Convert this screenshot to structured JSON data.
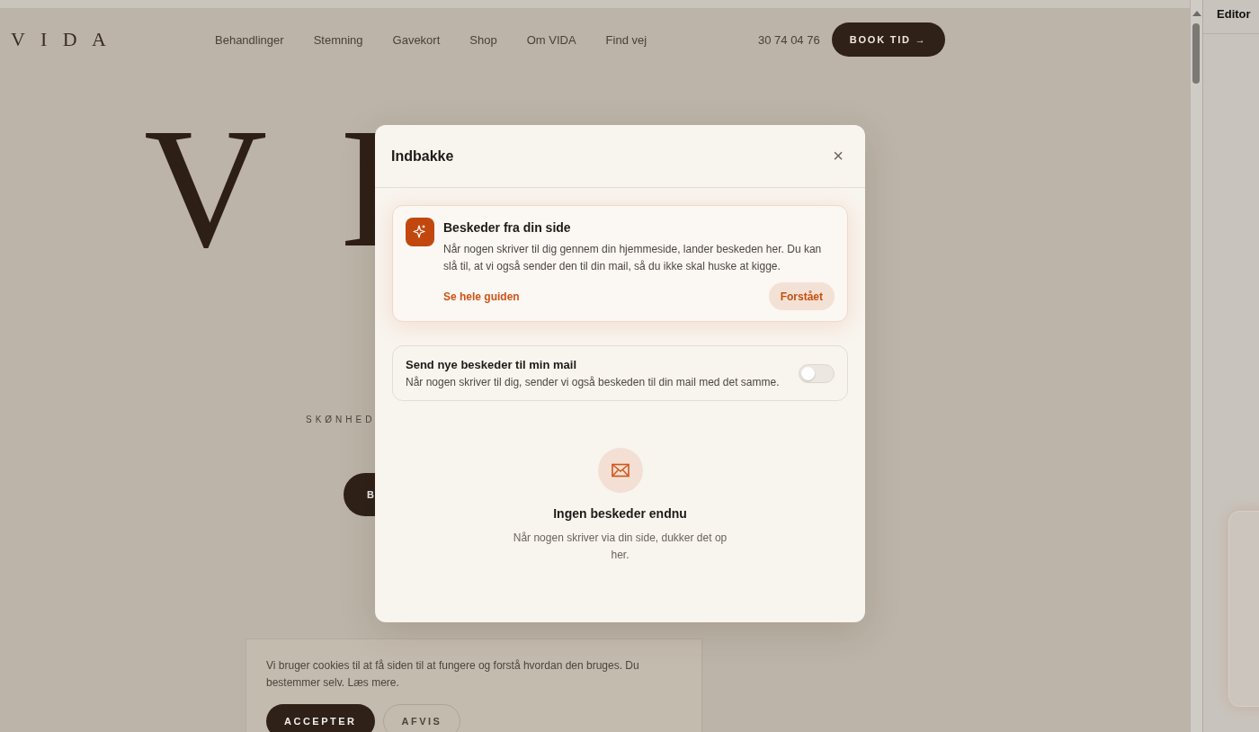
{
  "site": {
    "logo": "V I D A",
    "nav": [
      {
        "label": "Behandlinger"
      },
      {
        "label": "Stemning"
      },
      {
        "label": "Gavekort"
      },
      {
        "label": "Shop"
      },
      {
        "label": "Om VIDA"
      },
      {
        "label": "Find vej"
      }
    ],
    "phone": "30 74 04 76",
    "cta": "BOOK TID →",
    "hero_letters": [
      "V",
      "I"
    ],
    "tagline": "SKØNHED",
    "hero_button": "B"
  },
  "modal": {
    "title": "Indbakke",
    "close": "×",
    "guide": {
      "title": "Beskeder fra din side",
      "text": "Når nogen skriver til dig gennem din hjemmeside, lander beskeden her. Du kan slå til, at vi også sender den til din mail, så du ikke skal huske at kigge.",
      "link": "Se hele guiden",
      "button": "Forstået"
    },
    "setting": {
      "title": "Send nye beskeder til min mail",
      "text": "Når nogen skriver til dig, sender vi også beskeden til din mail med det samme.",
      "on": false
    },
    "empty": {
      "title": "Ingen beskeder endnu",
      "text": "Når nogen skriver via din side, dukker det op her."
    }
  },
  "cookie": {
    "text": "Vi bruger cookies til at få siden til at fungere og forstå hvordan den bruges. Du bestemmer selv. Læs mere.",
    "buttons": [
      {
        "label": "ACCEPTER",
        "kind": "primary"
      },
      {
        "label": "AFVIS",
        "kind": "secondary"
      }
    ]
  },
  "editor": {
    "title": "Editor"
  }
}
